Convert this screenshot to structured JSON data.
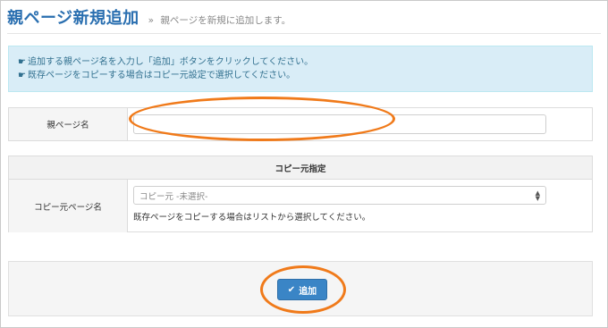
{
  "header": {
    "title": "親ページ新規追加",
    "separator": "»",
    "subtitle": "親ページを新規に追加します。"
  },
  "info": {
    "icon": "pointing-hand-icon",
    "lines": [
      "追加する親ページ名を入力し「追加」ボタンをクリックしてください。",
      "既存ページをコピーする場合はコピー元設定で選択してください。"
    ]
  },
  "form": {
    "parent_name_label": "親ページ名",
    "parent_name_value": "",
    "copy_section_title": "コピー元指定",
    "copy_source_label": "コピー元ページ名",
    "copy_source_selected": "コピー元 -未選択-",
    "copy_source_help": "既存ページをコピーする場合はリストから選択してください。"
  },
  "actions": {
    "add_label": "追加",
    "add_icon": "checkmark-icon"
  },
  "colors": {
    "accent": "#2a6fb0",
    "button": "#3a85c6",
    "info_bg": "#d9edf7",
    "annotation": "#f07a1a"
  }
}
